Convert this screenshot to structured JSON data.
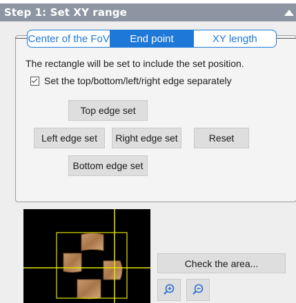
{
  "panel": {
    "title": "Step 1: Set XY range"
  },
  "tabs": [
    {
      "label": "Center of the FoV",
      "active": false
    },
    {
      "label": "End point",
      "active": true
    },
    {
      "label": "XY length",
      "active": false
    }
  ],
  "description": "The rectangle will be set to include the set position.",
  "separate_edges": {
    "label": "Set the top/bottom/left/right edge separately",
    "checked": true
  },
  "buttons": {
    "top": "Top edge set",
    "left": "Left edge set",
    "right": "Right edge set",
    "reset": "Reset",
    "bottom": "Bottom edge set",
    "check_area": "Check the area..."
  },
  "colors": {
    "header_bg": "#8c95a1",
    "tab_accent": "#1e78d7",
    "overlay_lines": "#e6e600",
    "preview_bg": "#000000"
  },
  "icons": {
    "zoom_in": "zoom-in-icon",
    "zoom_out": "zoom-out-icon",
    "collapse": "triangle-up-icon"
  }
}
